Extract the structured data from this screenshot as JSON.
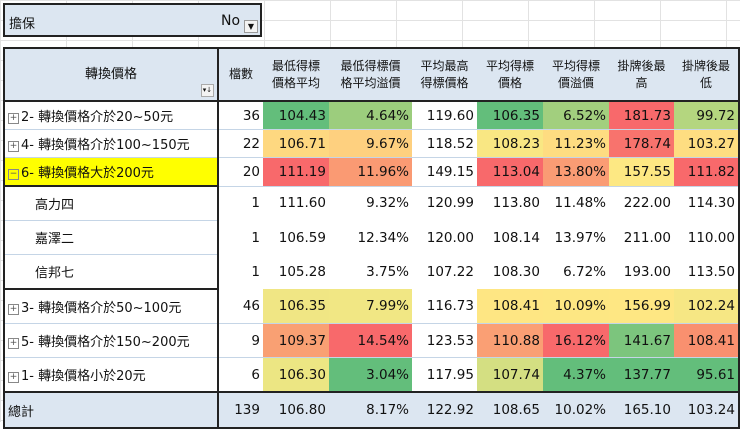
{
  "filter": {
    "label": "擔保",
    "value": "No"
  },
  "headers": [
    "轉換價格",
    "檔數",
    "最低得標價格平均",
    "最低得標價格平均溢價",
    "平均最高得標價格",
    "平均得標價格",
    "平均得標價溢價",
    "掛牌後最高",
    "掛牌後最低"
  ],
  "rows": [
    {
      "label": "2- 轉換價格介於20~50元",
      "expand": "+",
      "cells": [
        "36",
        "104.43",
        "4.64%",
        "119.60",
        "106.35",
        "6.52%",
        "181.73",
        "99.72"
      ],
      "colors": [
        "",
        "#63be7b",
        "#9ccd7d",
        "",
        "#63be7b",
        "#a2cf7e",
        "#f8696b",
        "#b4d67f"
      ]
    },
    {
      "label": "4- 轉換價格介於100~150元",
      "expand": "+",
      "cells": [
        "22",
        "106.71",
        "9.67%",
        "118.52",
        "108.23",
        "11.23%",
        "178.74",
        "103.27"
      ],
      "colors": [
        "",
        "#fed880",
        "#fed07f",
        "",
        "#f9e783",
        "#fedc81",
        "#f8736d",
        "#fedd81"
      ]
    },
    {
      "label": "6- 轉換價格大於200元",
      "expand": "−",
      "selected": true,
      "cells": [
        "20",
        "111.19",
        "11.96%",
        "149.15",
        "113.04",
        "13.80%",
        "157.55",
        "111.82"
      ],
      "colors": [
        "",
        "#f8696b",
        "#fa9a73",
        "",
        "#f8696b",
        "#fa9c74",
        "#fde883",
        "#f8696b"
      ]
    },
    {
      "label": "高力四",
      "child": true,
      "cells": [
        "1",
        "111.60",
        "9.32%",
        "120.99",
        "113.80",
        "11.48%",
        "222.00",
        "114.30"
      ]
    },
    {
      "label": "嘉澤二",
      "child": true,
      "cells": [
        "1",
        "106.59",
        "12.34%",
        "120.00",
        "108.14",
        "13.97%",
        "211.00",
        "110.00"
      ]
    },
    {
      "label": "信邦七",
      "child": true,
      "cells": [
        "1",
        "105.28",
        "3.75%",
        "107.22",
        "108.30",
        "6.72%",
        "193.00",
        "113.50"
      ]
    },
    {
      "label": "3- 轉換價格介於50~100元",
      "expand": "+",
      "cells": [
        "46",
        "106.35",
        "7.99%",
        "116.73",
        "108.41",
        "10.09%",
        "156.99",
        "102.24"
      ],
      "colors": [
        "",
        "#f0e684",
        "#f1e784",
        "",
        "#fee683",
        "#fde783",
        "#fee783",
        "#f6e784"
      ]
    },
    {
      "label": "5- 轉換價格介於150~200元",
      "expand": "+",
      "cells": [
        "9",
        "109.37",
        "14.54%",
        "123.53",
        "110.88",
        "16.12%",
        "141.67",
        "108.41"
      ],
      "colors": [
        "",
        "#f9a073",
        "#f8696b",
        "",
        "#fa9f74",
        "#f8696b",
        "#7cc57d",
        "#f9906f"
      ]
    },
    {
      "label": "1- 轉換價格小於20元",
      "expand": "+",
      "cells": [
        "6",
        "106.30",
        "3.04%",
        "117.95",
        "107.74",
        "4.37%",
        "137.77",
        "95.61"
      ],
      "colors": [
        "",
        "#ece683",
        "#63be7b",
        "",
        "#d4df82",
        "#63be7b",
        "#63be7b",
        "#63be7b"
      ]
    }
  ],
  "total": {
    "label": "總計",
    "cells": [
      "139",
      "106.80",
      "8.17%",
      "122.92",
      "108.65",
      "10.02%",
      "165.10",
      "103.24"
    ]
  }
}
